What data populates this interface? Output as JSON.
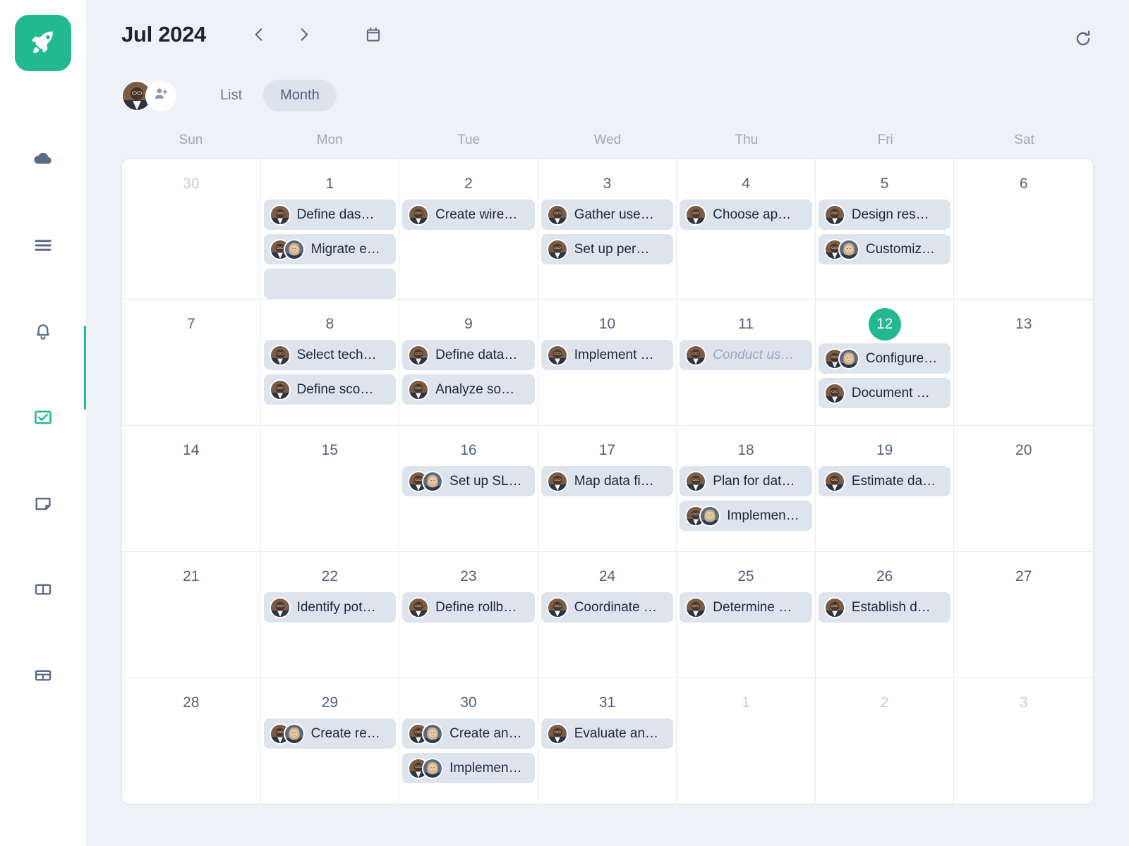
{
  "brand": {
    "accent": "#21b892",
    "logo_icon": "rocket-icon"
  },
  "sidebar": {
    "items": [
      {
        "icon": "cloud-icon",
        "active": false
      },
      {
        "icon": "list-lines-icon",
        "active": false
      },
      {
        "icon": "bell-icon",
        "active": false
      },
      {
        "icon": "checkbox-check-icon",
        "active": true
      },
      {
        "icon": "note-icon",
        "active": false
      },
      {
        "icon": "columns-icon",
        "active": false
      },
      {
        "icon": "table-icon",
        "active": false
      }
    ]
  },
  "header": {
    "title": "Jul 2024",
    "prev_icon": "chevron-left-icon",
    "next_icon": "chevron-right-icon",
    "calendar_icon": "calendar-icon",
    "refresh_icon": "refresh-icon",
    "add_person_icon": "add-person-icon"
  },
  "view_tabs": [
    {
      "label": "List",
      "active": false
    },
    {
      "label": "Month",
      "active": true
    }
  ],
  "weekdays": [
    "Sun",
    "Mon",
    "Tue",
    "Wed",
    "Thu",
    "Fri",
    "Sat"
  ],
  "calendar": {
    "weeks": [
      [
        {
          "day": "30",
          "muted": true,
          "today": false,
          "tasks": []
        },
        {
          "day": "1",
          "muted": false,
          "today": false,
          "tasks": [
            {
              "text": "Define das…",
              "avatars": 1,
              "done": false
            },
            {
              "text": "Migrate e…",
              "avatars": 2,
              "done": false
            },
            {
              "text": "",
              "avatars": 0,
              "done": false
            }
          ]
        },
        {
          "day": "2",
          "muted": false,
          "today": false,
          "tasks": [
            {
              "text": "Create wire…",
              "avatars": 1,
              "done": false
            }
          ]
        },
        {
          "day": "3",
          "muted": false,
          "today": false,
          "tasks": [
            {
              "text": "Gather use…",
              "avatars": 1,
              "done": false
            },
            {
              "text": "Set up per…",
              "avatars": 1,
              "done": false
            }
          ]
        },
        {
          "day": "4",
          "muted": false,
          "today": false,
          "tasks": [
            {
              "text": "Choose ap…",
              "avatars": 1,
              "done": false
            }
          ]
        },
        {
          "day": "5",
          "muted": false,
          "today": false,
          "tasks": [
            {
              "text": "Design res…",
              "avatars": 1,
              "done": false
            },
            {
              "text": "Customiz…",
              "avatars": 2,
              "done": false
            }
          ]
        },
        {
          "day": "6",
          "muted": false,
          "today": false,
          "tasks": []
        }
      ],
      [
        {
          "day": "7",
          "muted": false,
          "today": false,
          "tasks": []
        },
        {
          "day": "8",
          "muted": false,
          "today": false,
          "tasks": [
            {
              "text": "Select tech…",
              "avatars": 1,
              "done": false
            },
            {
              "text": "Define sco…",
              "avatars": 1,
              "done": false
            }
          ]
        },
        {
          "day": "9",
          "muted": false,
          "today": false,
          "tasks": [
            {
              "text": "Define data…",
              "avatars": 1,
              "done": false
            },
            {
              "text": "Analyze so…",
              "avatars": 1,
              "done": false
            }
          ]
        },
        {
          "day": "10",
          "muted": false,
          "today": false,
          "tasks": [
            {
              "text": "Implement …",
              "avatars": 1,
              "done": false
            }
          ]
        },
        {
          "day": "11",
          "muted": false,
          "today": false,
          "tasks": [
            {
              "text": "Conduct us…",
              "avatars": 1,
              "done": true
            }
          ]
        },
        {
          "day": "12",
          "muted": false,
          "today": true,
          "tasks": [
            {
              "text": "Configure…",
              "avatars": 2,
              "done": false
            },
            {
              "text": "Document …",
              "avatars": 1,
              "done": false
            }
          ]
        },
        {
          "day": "13",
          "muted": false,
          "today": false,
          "tasks": []
        }
      ],
      [
        {
          "day": "14",
          "muted": false,
          "today": false,
          "tasks": []
        },
        {
          "day": "15",
          "muted": false,
          "today": false,
          "tasks": []
        },
        {
          "day": "16",
          "muted": false,
          "today": false,
          "tasks": [
            {
              "text": "Set up SL…",
              "avatars": 2,
              "done": false
            }
          ]
        },
        {
          "day": "17",
          "muted": false,
          "today": false,
          "tasks": [
            {
              "text": "Map data fi…",
              "avatars": 1,
              "done": false
            }
          ]
        },
        {
          "day": "18",
          "muted": false,
          "today": false,
          "tasks": [
            {
              "text": "Plan for dat…",
              "avatars": 1,
              "done": false
            },
            {
              "text": "Implemen…",
              "avatars": 2,
              "done": false
            }
          ]
        },
        {
          "day": "19",
          "muted": false,
          "today": false,
          "tasks": [
            {
              "text": "Estimate da…",
              "avatars": 1,
              "done": false
            }
          ]
        },
        {
          "day": "20",
          "muted": false,
          "today": false,
          "tasks": []
        }
      ],
      [
        {
          "day": "21",
          "muted": false,
          "today": false,
          "tasks": []
        },
        {
          "day": "22",
          "muted": false,
          "today": false,
          "tasks": [
            {
              "text": "Identify pot…",
              "avatars": 1,
              "done": false
            }
          ]
        },
        {
          "day": "23",
          "muted": false,
          "today": false,
          "tasks": [
            {
              "text": "Define rollb…",
              "avatars": 1,
              "done": false
            }
          ]
        },
        {
          "day": "24",
          "muted": false,
          "today": false,
          "tasks": [
            {
              "text": "Coordinate …",
              "avatars": 1,
              "done": false
            }
          ]
        },
        {
          "day": "25",
          "muted": false,
          "today": false,
          "tasks": [
            {
              "text": "Determine …",
              "avatars": 1,
              "done": false
            }
          ]
        },
        {
          "day": "26",
          "muted": false,
          "today": false,
          "tasks": [
            {
              "text": "Establish d…",
              "avatars": 1,
              "done": false
            }
          ]
        },
        {
          "day": "27",
          "muted": false,
          "today": false,
          "tasks": []
        }
      ],
      [
        {
          "day": "28",
          "muted": false,
          "today": false,
          "tasks": []
        },
        {
          "day": "29",
          "muted": false,
          "today": false,
          "tasks": [
            {
              "text": "Create re…",
              "avatars": 2,
              "done": false
            }
          ]
        },
        {
          "day": "30",
          "muted": false,
          "today": false,
          "tasks": [
            {
              "text": "Create an…",
              "avatars": 2,
              "done": false
            },
            {
              "text": "Implemen…",
              "avatars": 2,
              "done": false
            }
          ]
        },
        {
          "day": "31",
          "muted": false,
          "today": false,
          "tasks": [
            {
              "text": "Evaluate an…",
              "avatars": 1,
              "done": false
            }
          ]
        },
        {
          "day": "1",
          "muted": true,
          "today": false,
          "tasks": []
        },
        {
          "day": "2",
          "muted": true,
          "today": false,
          "tasks": []
        },
        {
          "day": "3",
          "muted": true,
          "today": false,
          "tasks": []
        }
      ]
    ]
  }
}
